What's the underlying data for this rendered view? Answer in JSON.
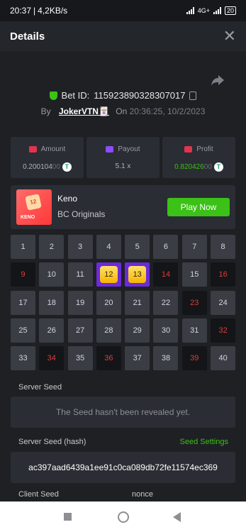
{
  "status": {
    "time": "20:37",
    "speed": "4,2KB/s",
    "network": "4G+",
    "battery": "20"
  },
  "header": {
    "title": "Details",
    "close_icon": "close-icon"
  },
  "bet": {
    "id_label": "Bet ID:",
    "id": "115923890328307017",
    "by_label": "By",
    "user": "JokerVTN🃏",
    "on_label": "On",
    "timestamp": "20:36:25, 10/2/2023"
  },
  "stats": [
    {
      "label": "Amount",
      "value_main": "0.200104",
      "value_tail": "00",
      "icon": "amount-icon",
      "color": "#e8e8ea"
    },
    {
      "label": "Payout",
      "value_main": "5.1 x",
      "value_tail": "",
      "icon": "payout-icon",
      "color": "#b0b2b8"
    },
    {
      "label": "Profit",
      "value_main": "0.820426",
      "value_tail": "00",
      "icon": "profit-icon",
      "color": "#3bc117"
    }
  ],
  "game": {
    "name": "Keno",
    "provider": "BC Originals",
    "thumb_number": "12",
    "thumb_word": "KENO",
    "play_label": "Play Now"
  },
  "keno": {
    "numbers": [
      1,
      2,
      3,
      4,
      5,
      6,
      7,
      8,
      9,
      10,
      11,
      12,
      13,
      14,
      15,
      16,
      17,
      18,
      19,
      20,
      21,
      22,
      23,
      24,
      25,
      26,
      27,
      28,
      29,
      30,
      31,
      32,
      33,
      34,
      35,
      36,
      37,
      38,
      39,
      40
    ],
    "hits": [
      12,
      13
    ],
    "misses": [
      9,
      14,
      16,
      23,
      32,
      34,
      36,
      39
    ]
  },
  "seeds": {
    "server_label": "Server Seed",
    "server_value": "The Seed hasn't been revealed yet.",
    "hash_label": "Server Seed (hash)",
    "settings_label": "Seed Settings",
    "hash_value": "ac397aad6439a1ee91c0ca089db72fe11574ec369",
    "client_label": "Client Seed",
    "nonce_label": "nonce"
  },
  "colors": {
    "accent": "#3bc117",
    "hit": "#6c2bd9",
    "miss": "#e03a3a"
  }
}
